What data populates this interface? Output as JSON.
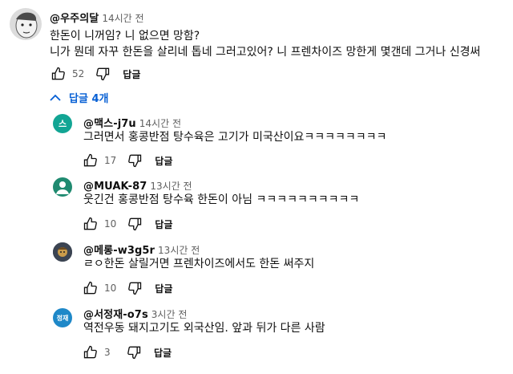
{
  "main_comment": {
    "author": "@우주의달",
    "time": "14시간 전",
    "lines": [
      "한돈이 니꺼임? 니 없으면 망함?",
      "니가 뭔데 자꾸 한돈을 살리네 톱네 그러고있어? 니 프렌차이즈 망한게 몇갠데 그거나 신경써"
    ],
    "likes": "52",
    "reply_label": "답글",
    "avatar_icon": "cartoon-face-avatar"
  },
  "replies_toggle": {
    "label": "답글 4개",
    "icon": "chevron-up-icon",
    "color": "#065fd4"
  },
  "replies": [
    {
      "author": "@맥스-j7u",
      "time": "14시간 전",
      "text": "그러면서 홍콩반점 탕수육은 고기가 미국산이요ㅋㅋㅋㅋㅋㅋㅋㅋ",
      "likes": "17",
      "reply_label": "답글",
      "avatar_letter": "스",
      "avatar_color": "#12a594"
    },
    {
      "author": "@MUAK-87",
      "time": "13시간 전",
      "text": "웃긴건 홍콩반점 탕수육 한돈이 아님 ㅋㅋㅋㅋㅋㅋㅋㅋㅋㅋ",
      "likes": "10",
      "reply_label": "답글",
      "avatar_icon": "person-icon",
      "avatar_color": "#1f8a70"
    },
    {
      "author": "@메롱-w3g5r",
      "time": "13시간 전",
      "text": "ㄹㅇ한돈 살릴거면 프렌차이즈에서도 한돈 써주지",
      "likes": "10",
      "reply_label": "답글",
      "avatar_icon": "character-avatar",
      "avatar_color": "#3b4452"
    },
    {
      "author": "@서정재-o7s",
      "time": "3시간 전",
      "text": "역전우동 돼지고기도 외국산임. 앞과 뒤가 다른 사람",
      "likes": "3",
      "reply_label": "답글",
      "avatar_letter": "정재",
      "avatar_color": "#1e88c8"
    }
  ]
}
